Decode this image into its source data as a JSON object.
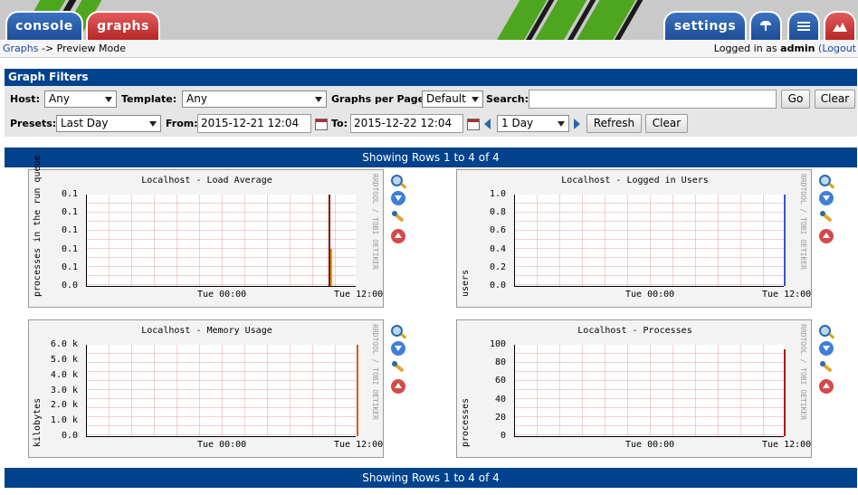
{
  "tabs": {
    "console": "console",
    "graphs": "graphs",
    "settings": "settings"
  },
  "breadcrumb": {
    "link": "Graphs",
    "separator": "->",
    "current": "Preview Mode"
  },
  "login": {
    "prefix": "Logged in as",
    "user": "admin",
    "logout": "(Logout"
  },
  "filters": {
    "title": "Graph Filters",
    "host_label": "Host:",
    "host_value": "Any",
    "template_label": "Template:",
    "template_value": "Any",
    "gpp_label": "Graphs per Page:",
    "gpp_value": "Default",
    "search_label": "Search:",
    "search_value": "",
    "go": "Go",
    "clear": "Clear",
    "presets_label": "Presets:",
    "presets_value": "Last Day",
    "from_label": "From:",
    "from_value": "2015-12-21 12:04",
    "to_label": "To:",
    "to_value": "2015-12-22 12:04",
    "span_value": "1 Day",
    "refresh": "Refresh",
    "clear2": "Clear"
  },
  "rows_text": "Showing Rows 1 to 4 of 4",
  "watermark": "RRDTOOL / TOBI OETIKER",
  "graphs": [
    {
      "title": "Localhost - Load Average",
      "ylabel": "processes in the run queue",
      "yticks": [
        "0.1",
        "0.1",
        "0.1",
        "0.1",
        "0.1",
        "0.0"
      ],
      "xticks": [
        "Tue 00:00",
        "Tue 12:00"
      ],
      "chart_data": {
        "type": "area",
        "title": "Localhost - Load Average",
        "ylabel": "processes in the run queue",
        "series": [
          {
            "value": 0.1
          }
        ],
        "color": "#8b0000"
      }
    },
    {
      "title": "Localhost - Logged in Users",
      "ylabel": "users",
      "yticks": [
        "1.0",
        "0.8",
        "0.6",
        "0.4",
        "0.2",
        "0.0"
      ],
      "xticks": [
        "Tue 00:00",
        "Tue 12:00"
      ],
      "chart_data": {
        "type": "line",
        "title": "Localhost - Logged in Users",
        "ylabel": "users",
        "ylim": [
          0,
          1.0
        ],
        "series": [
          {
            "value": 1.0
          }
        ],
        "color": "#3355cc"
      }
    },
    {
      "title": "Localhost - Memory Usage",
      "ylabel": "kilobytes",
      "yticks": [
        "6.0 k",
        "5.0 k",
        "4.0 k",
        "3.0 k",
        "2.0 k",
        "1.0 k",
        "0.0"
      ],
      "xticks": [
        "Tue 00:00",
        "Tue 12:00"
      ],
      "chart_data": {
        "type": "area",
        "title": "Localhost - Memory Usage",
        "ylabel": "kilobytes",
        "ylim": [
          0,
          6000
        ],
        "series": [
          {
            "value": 6500
          }
        ],
        "color": "#e05a1f"
      }
    },
    {
      "title": "Localhost - Processes",
      "ylabel": "processes",
      "yticks": [
        "100",
        "80",
        "60",
        "40",
        "20",
        "0"
      ],
      "xticks": [
        "Tue 00:00",
        "Tue 12:00"
      ],
      "chart_data": {
        "type": "area",
        "title": "Localhost - Processes",
        "ylabel": "processes",
        "ylim": [
          0,
          100
        ],
        "series": [
          {
            "value": 95
          }
        ],
        "color": "#b01010"
      }
    }
  ]
}
